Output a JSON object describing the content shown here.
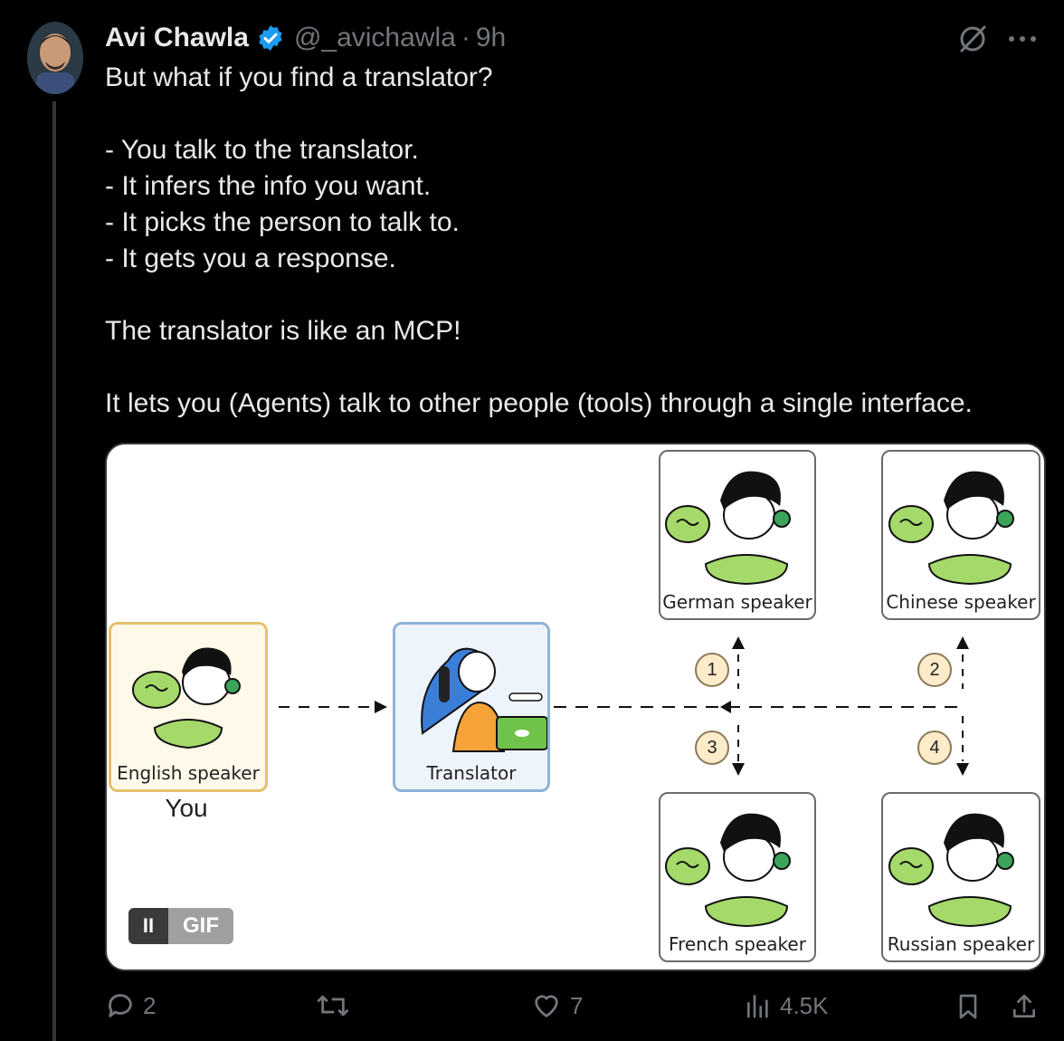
{
  "tweet": {
    "author_name": "Avi Chawla",
    "handle": "@_avichawla",
    "separator": "·",
    "time": "9h",
    "text": "But what if you find a translator?\n\n- You talk to the translator.\n- It infers the info you want.\n- It picks the person to talk to.\n- It gets you a response.\n\nThe translator is like an MCP!\n\nIt lets you (Agents) talk to other people (tools) through a single interface."
  },
  "media": {
    "english_label": "English speaker",
    "you_label": "You",
    "translator_label": "Translator",
    "german_label": "German speaker",
    "chinese_label": "Chinese speaker",
    "french_label": "French speaker",
    "russian_label": "Russian speaker",
    "steps": [
      "1",
      "2",
      "3",
      "4"
    ],
    "gif_label": "GIF",
    "pause_label": "II"
  },
  "actions": {
    "replies": "2",
    "retweets": "",
    "likes": "7",
    "views": "4.5K"
  },
  "colors": {
    "background": "#000000",
    "text": "#e7e9ea",
    "muted": "#71767b",
    "verified": "#1d9bf0",
    "accent_green": "#a5d96a"
  }
}
